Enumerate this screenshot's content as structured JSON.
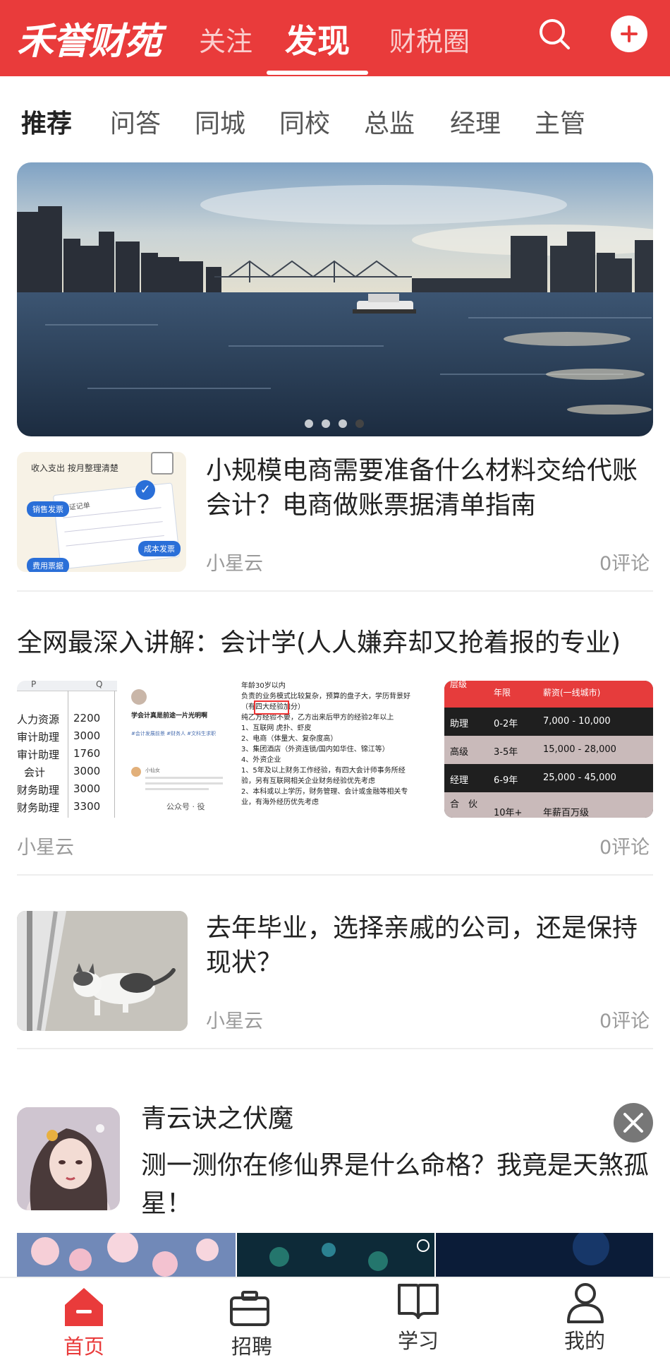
{
  "header": {
    "logo": "禾誉财苑",
    "nav": [
      "关注",
      "发现",
      "财税圈"
    ],
    "active_nav": "发现"
  },
  "categories": [
    "推荐",
    "问答",
    "同城",
    "同校",
    "总监",
    "经理",
    "主管"
  ],
  "banner": {
    "slide_count": 4,
    "active_slide": 4
  },
  "articles": [
    {
      "title": "小规模电商需要准备什么材料交给代账会计？电商做账票据清单指南",
      "author": "小星云",
      "comments": "0评论",
      "thumb_text": {
        "top": "收入支出 按月整理清楚",
        "tag1": "销售发票",
        "tag2": "成本发票",
        "tag3": "费用票据",
        "card": "凭证记单"
      }
    },
    {
      "title": "全网最深入讲解：会计学(人人嫌弃却又抢着报的专业)",
      "author": "小星云",
      "comments": "0评论",
      "img1": {
        "col_p": "P",
        "col_q": "Q",
        "rows": [
          {
            "label": "人力资源",
            "value": "2200"
          },
          {
            "label": "审计助理",
            "value": "3000"
          },
          {
            "label": "审计助理",
            "value": "1760"
          },
          {
            "label": "会计",
            "value": "3000"
          },
          {
            "label": "财务助理",
            "value": "3000"
          },
          {
            "label": "财务助理",
            "value": "3300"
          }
        ]
      },
      "img2": {
        "post_title": "学会计真是前途一片光明啊",
        "tags": "#会计发展前景 #财务人 #文科生求职",
        "reply": "小仙女",
        "watermark": "公众号 · 役"
      },
      "img3": {
        "lines": [
          "年龄30岁以内",
          "负责的业务模式比较复杂，预算的盘子大，学历背景好",
          "（有四大经验加分）",
          "纯乙方经验不要，乙方出来后甲方的经验2年以上",
          "1、互联网 虎扑、虾皮",
          "2、电商（体量大、复杂度高）",
          "3、集团酒店（外资连锁/国内如华住、锦江等）",
          "4、外资企业",
          "1、5年及以上财务工作经验，有四大会计师事务所经",
          "验，另有互联网相关企业财务经验优先考虑",
          "2、本科或以上学历，财务管理、会计或金融等相关专",
          "业，有海外经历优先考虑"
        ]
      },
      "img4": {
        "headers": [
          "层级",
          "年限",
          "薪资(一线城市)"
        ],
        "rows": [
          [
            "助理",
            "0-2年",
            "7,000 - 10,000"
          ],
          [
            "高级",
            "3-5年",
            "15,000 - 28,000"
          ],
          [
            "经理",
            "6-9年",
            "25,000 - 45,000"
          ],
          [
            "合　伙",
            "10年+",
            "年薪百万级"
          ]
        ]
      }
    },
    {
      "title": "去年毕业，选择亲戚的公司，还是保持现状？",
      "author": "小星云",
      "comments": "0评论"
    }
  ],
  "ad": {
    "name": "青云诀之伏魔",
    "text": "测一测你在修仙界是什么命格？我竟是天煞孤星！"
  },
  "bottom_nav": [
    {
      "label": "首页",
      "icon": "home-icon",
      "active": true
    },
    {
      "label": "招聘",
      "icon": "briefcase-icon",
      "active": false
    },
    {
      "label": "学习",
      "icon": "book-icon",
      "active": false
    },
    {
      "label": "我的",
      "icon": "user-icon",
      "active": false
    }
  ],
  "colors": {
    "brand": "#e93b3b",
    "muted": "#9a9a9a"
  }
}
